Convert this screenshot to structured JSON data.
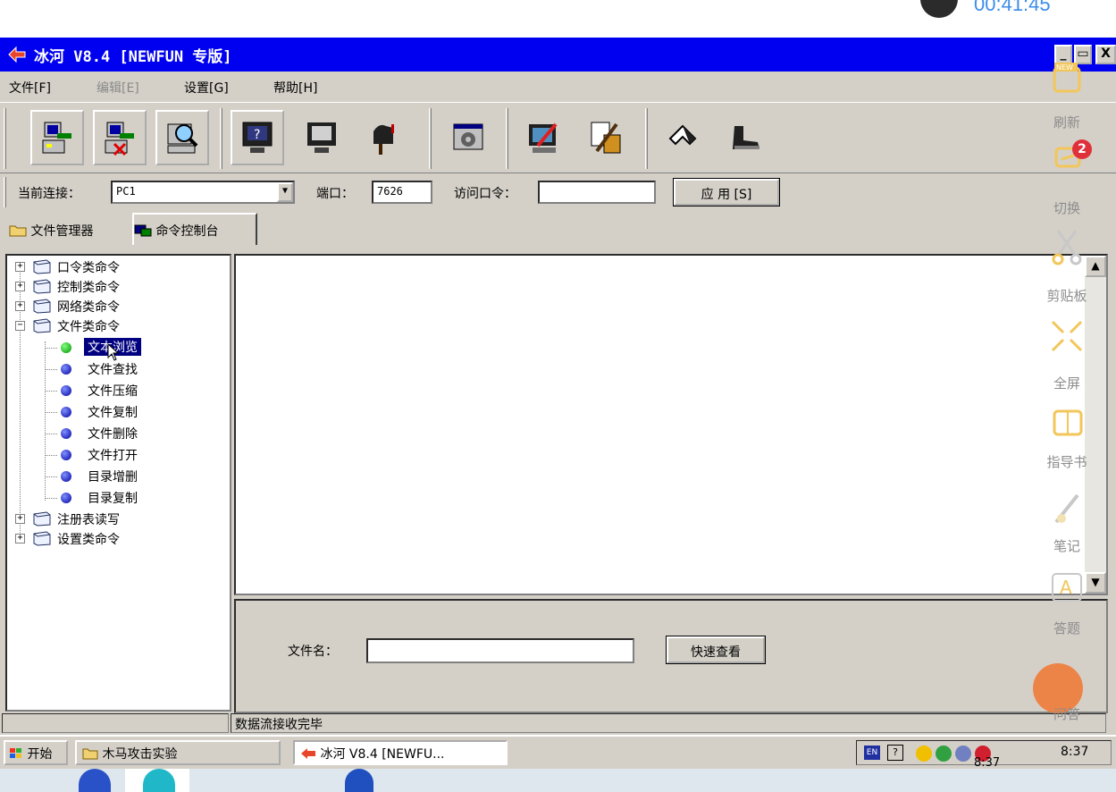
{
  "timer": {
    "text": "00:41:45"
  },
  "window": {
    "title": "冰河 V8.4 [NEWFUN 专版]",
    "controls": {
      "minimize": "_",
      "restore": "▭",
      "close": "X"
    }
  },
  "menu": {
    "file": "文件[F]",
    "edit": "编辑[E]",
    "settings": "设置[G]",
    "help": "帮助[H]"
  },
  "connection": {
    "current_label": "当前连接：",
    "current_value": "PC1",
    "port_label": "端口：",
    "port_value": "7626",
    "password_label": "访问口令：",
    "password_value": "",
    "apply_label": "应 用 [S]"
  },
  "tabs": {
    "file_manager": "文件管理器",
    "command_console": "命令控制台"
  },
  "tree": {
    "cat_password": "口令类命令",
    "cat_control": "控制类命令",
    "cat_network": "网络类命令",
    "cat_file": "文件类命令",
    "item_text_view": "文本浏览",
    "item_file_find": "文件查找",
    "item_file_compress": "文件压缩",
    "item_file_copy": "文件复制",
    "item_file_delete": "文件删除",
    "item_file_open": "文件打开",
    "item_dir_add_del": "目录增删",
    "item_dir_copy": "目录复制",
    "cat_registry": "注册表读写",
    "cat_settings": "设置类命令"
  },
  "form": {
    "filename_label": "文件名：",
    "filename_value": "",
    "quick_view_label": "快速查看"
  },
  "status": {
    "text": "数据流接收完毕"
  },
  "taskbar": {
    "start": "开始",
    "task_folder": "木马攻击实验",
    "task_app": "冰河 V8.4 [NEWFU...",
    "tray_lang": "EN",
    "tray_help": "?",
    "clock": "8:37"
  },
  "dock": {
    "clock": "8:37"
  },
  "overlay": {
    "refresh": "刷新",
    "switch": "切换",
    "switch_badge": "2",
    "clipboard": "剪贴板",
    "fullscreen": "全屏",
    "guide": "指导书",
    "notes": "笔记",
    "answer": "答题",
    "qa": "问答",
    "new_badge": "NEW"
  }
}
